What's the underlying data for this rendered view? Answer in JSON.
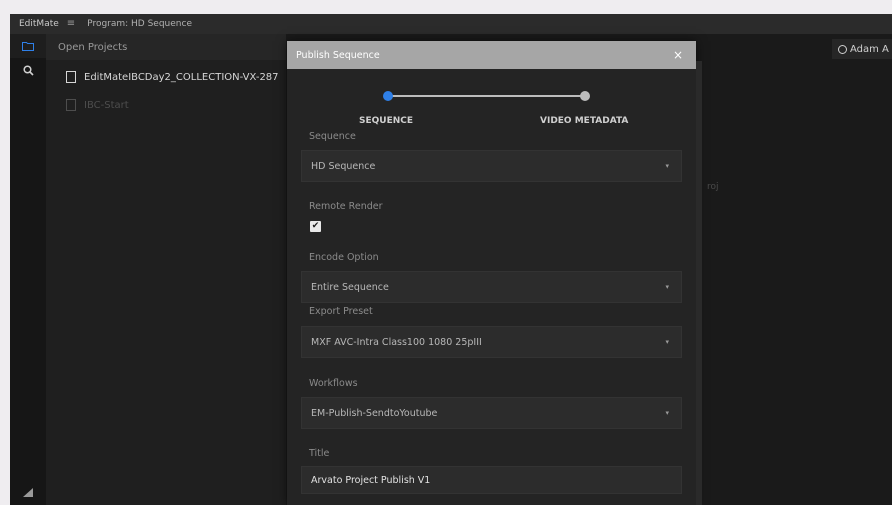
{
  "topbar": {
    "brand": "EditMate",
    "program": "Program: HD Sequence"
  },
  "sidebar": {
    "header": "Open Projects",
    "items": [
      {
        "label": "EditMateIBCDay2_COLLECTION-VX-287"
      },
      {
        "label": "IBC-Start"
      }
    ]
  },
  "main": {
    "user": "Adam A",
    "fragment": "roj"
  },
  "modal": {
    "title": "Publish Sequence",
    "steps": [
      {
        "label": "SEQUENCE",
        "active": true
      },
      {
        "label": "VIDEO METADATA",
        "active": false
      }
    ],
    "fields": {
      "sequence": {
        "label": "Sequence",
        "value": "HD Sequence"
      },
      "remote_render": {
        "label": "Remote Render",
        "checked": true
      },
      "encode_option": {
        "label": "Encode Option",
        "value": "Entire Sequence"
      },
      "export_preset": {
        "label": "Export Preset",
        "value": "MXF AVC-Intra Class100 1080 25pIII"
      },
      "workflows": {
        "label": "Workflows",
        "value": "EM-Publish-SendtoYoutube"
      },
      "title": {
        "label": "Title",
        "value": "Arvato Project Publish V1"
      }
    }
  },
  "colors": {
    "accent": "#2f80e8",
    "modal_header": "#a6a6a6",
    "background": "#1b1b1b"
  }
}
